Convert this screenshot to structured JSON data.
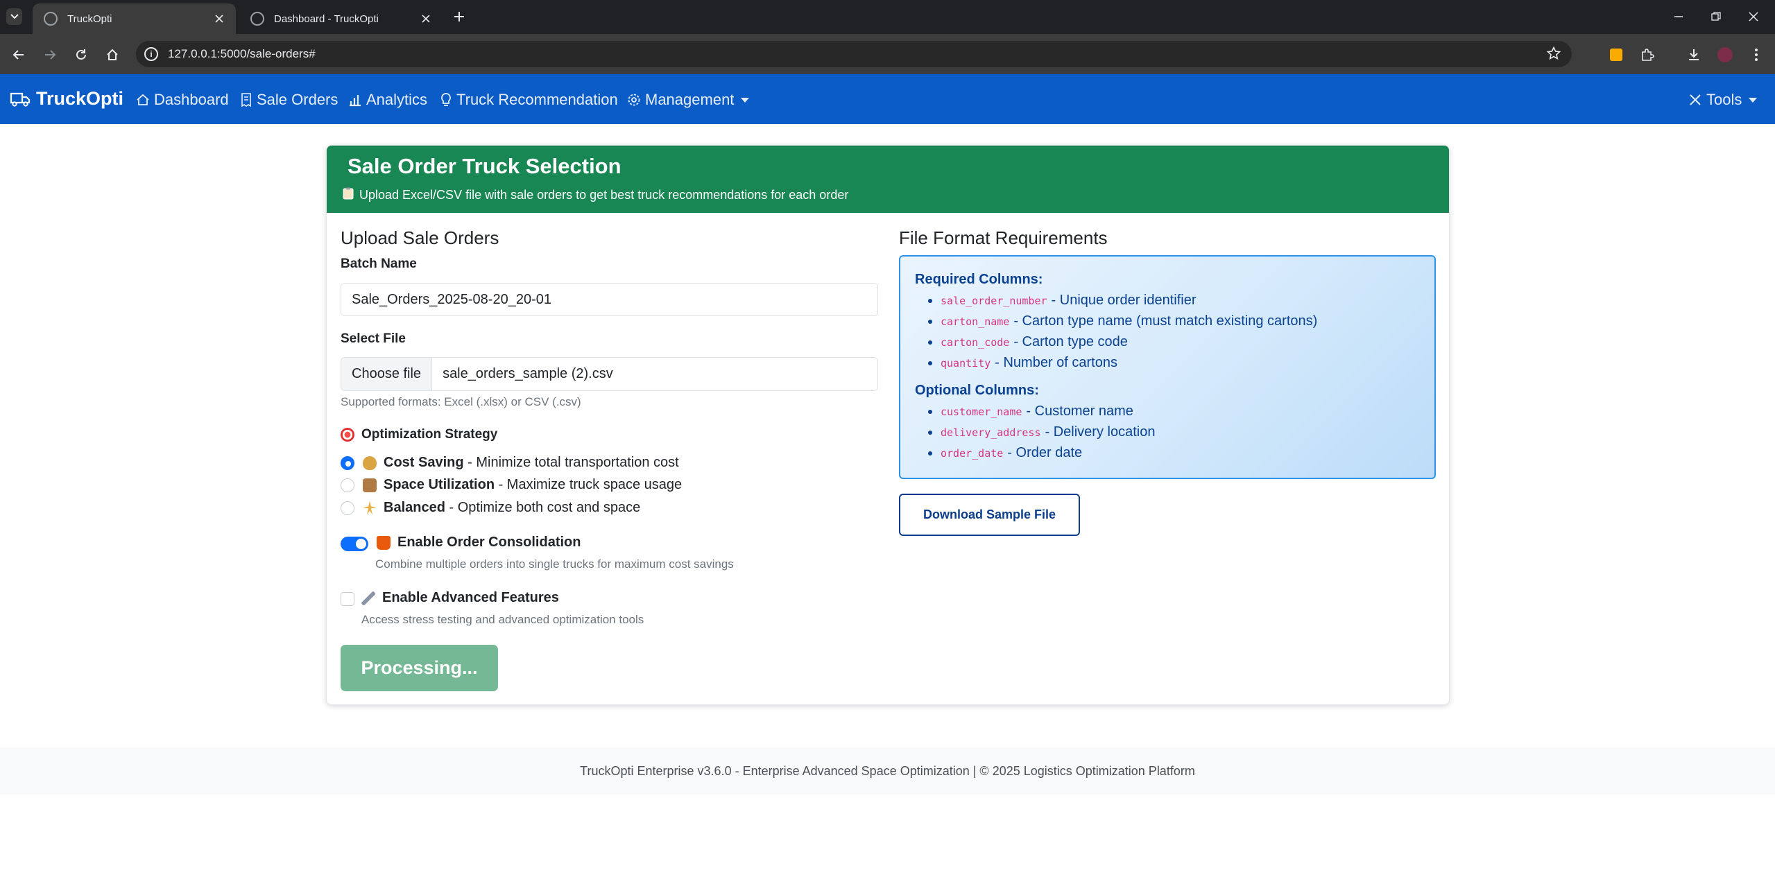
{
  "browser": {
    "tabs": [
      {
        "title": "TruckOpti",
        "active": true
      },
      {
        "title": "Dashboard - TruckOpti",
        "active": false
      }
    ],
    "url": "127.0.0.1:5000/sale-orders#"
  },
  "navbar": {
    "brand": "TruckOpti",
    "links": [
      {
        "label": "Dashboard",
        "icon": "house-icon"
      },
      {
        "label": "Sale Orders",
        "icon": "receipt-icon"
      },
      {
        "label": "Analytics",
        "icon": "bar-chart-icon"
      },
      {
        "label": "Truck Recommendation",
        "icon": "lightbulb-icon"
      },
      {
        "label": "Management",
        "icon": "gear-icon"
      }
    ],
    "tools_label": "Tools"
  },
  "card": {
    "title": "Sale Order Truck Selection",
    "subtitle": "Upload Excel/CSV file with sale orders to get best truck recommendations for each order"
  },
  "upload": {
    "heading": "Upload Sale Orders",
    "batch_label": "Batch Name",
    "batch_value": "Sale_Orders_2025-08-20_20-01",
    "file_label": "Select File",
    "file_button": "Choose file",
    "file_name": "sale_orders_sample (2).csv",
    "file_help": "Supported formats: Excel (.xlsx) or CSV (.csv)",
    "strategy_label": "Optimization Strategy",
    "strategies": [
      {
        "name": "Cost Saving",
        "desc": " - Minimize total transportation cost",
        "selected": true
      },
      {
        "name": "Space Utilization",
        "desc": " - Maximize truck space usage",
        "selected": false
      },
      {
        "name": "Balanced",
        "desc": " - Optimize both cost and space",
        "selected": false
      }
    ],
    "consolidation_label": "Enable Order Consolidation",
    "consolidation_help": "Combine multiple orders into single trucks for maximum cost savings",
    "consolidation_on": true,
    "advanced_label": "Enable Advanced Features",
    "advanced_help": "Access stress testing and advanced optimization tools",
    "advanced_on": false,
    "submit_label": "Processing..."
  },
  "requirements": {
    "heading": "File Format Requirements",
    "required_title": "Required Columns:",
    "required": [
      {
        "code": "sale_order_number",
        "desc": "- Unique order identifier"
      },
      {
        "code": "carton_name",
        "desc": "- Carton type name (must match existing cartons)"
      },
      {
        "code": "carton_code",
        "desc": "- Carton type code"
      },
      {
        "code": "quantity",
        "desc": "- Number of cartons"
      }
    ],
    "optional_title": "Optional Columns:",
    "optional": [
      {
        "code": "customer_name",
        "desc": "- Customer name"
      },
      {
        "code": "delivery_address",
        "desc": "- Delivery location"
      },
      {
        "code": "order_date",
        "desc": "- Order date"
      }
    ],
    "download_label": "Download Sample File"
  },
  "footer": {
    "text": "TruckOpti Enterprise v3.6.0 - Enterprise Advanced Space Optimization | © 2025 Logistics Optimization Platform"
  }
}
